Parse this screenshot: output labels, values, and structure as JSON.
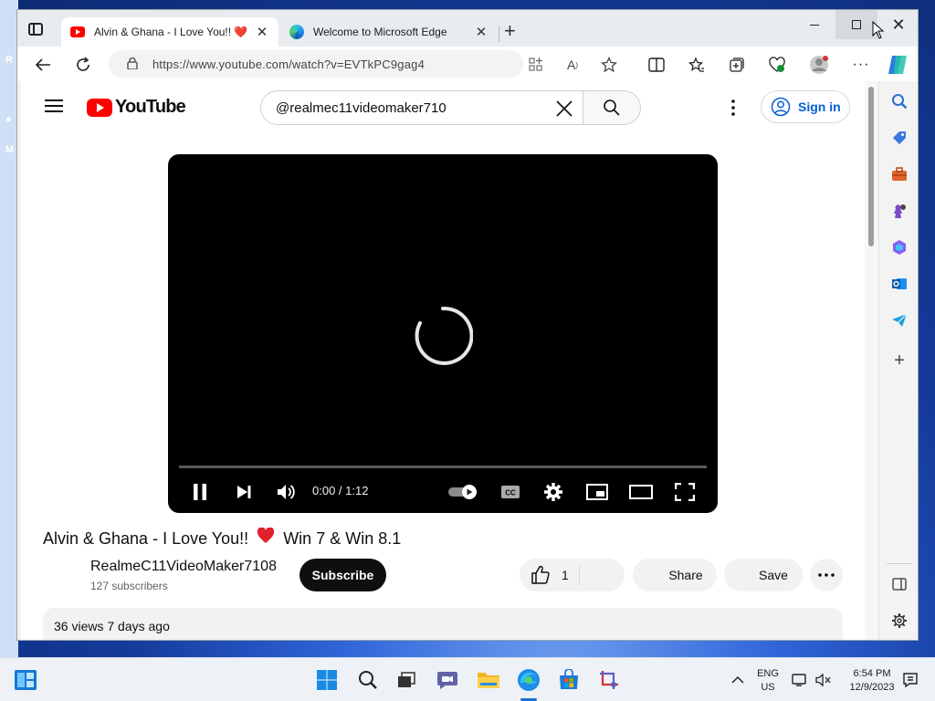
{
  "browser": {
    "tabs": [
      {
        "title": "Alvin & Ghana - I Love You!! ❤️",
        "active": true
      },
      {
        "title": "Welcome to Microsoft Edge",
        "active": false
      }
    ],
    "url": "https://www.youtube.com/watch?v=EVTkPC9gag4"
  },
  "youtube": {
    "logo_text": "YouTube",
    "search_value": "@realmec11videomaker710",
    "sign_in_label": "Sign in",
    "player": {
      "time": "0:00 / 1:12",
      "progress": 0
    },
    "video_title": "Alvin & Ghana - I Love You!!",
    "video_title_suffix": "Win 7 & Win 8.1",
    "channel_name": "RealmeC11VideoMaker7108",
    "subscribers": "127 subscribers",
    "subscribe_label": "Subscribe",
    "like_count": "1",
    "share_label": "Share",
    "save_label": "Save",
    "description_meta": "36 views  7 days ago"
  },
  "taskbar": {
    "language_line1": "ENG",
    "language_line2": "US",
    "clock_time": "6:54 PM",
    "clock_date": "12/9/2023"
  },
  "colors": {
    "youtube_red": "#ff0000",
    "link_blue": "#065fd4",
    "taskbar_bg": "#eef2f7"
  }
}
